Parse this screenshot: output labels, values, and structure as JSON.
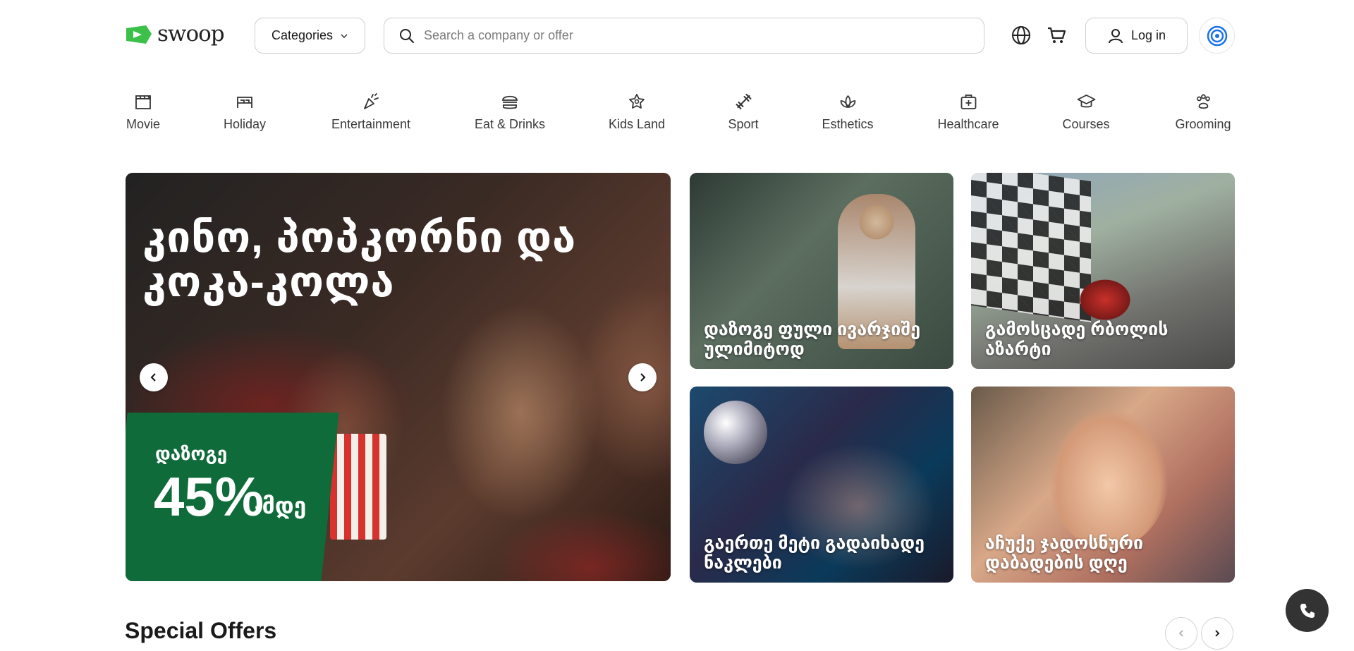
{
  "header": {
    "logo_text": "swoop",
    "categories_label": "Categories",
    "search_placeholder": "Search a company or offer",
    "login_label": "Log in"
  },
  "category_nav": [
    {
      "label": "Movie",
      "icon": "clapperboard-icon"
    },
    {
      "label": "Holiday",
      "icon": "bed-icon"
    },
    {
      "label": "Entertainment",
      "icon": "party-popper-icon"
    },
    {
      "label": "Eat & Drinks",
      "icon": "burger-icon"
    },
    {
      "label": "Kids Land",
      "icon": "star-badge-icon"
    },
    {
      "label": "Sport",
      "icon": "dumbbell-icon"
    },
    {
      "label": "Esthetics",
      "icon": "lotus-icon"
    },
    {
      "label": "Healthcare",
      "icon": "medical-kit-icon"
    },
    {
      "label": "Courses",
      "icon": "graduation-cap-icon"
    },
    {
      "label": "Grooming",
      "icon": "paw-icon"
    }
  ],
  "hero": {
    "title": "კინო, პოპკორნი და კოკა-კოლა",
    "deal_top": "დაზოგე",
    "deal_percent": "45%",
    "deal_suffix": "-მდე"
  },
  "tiles": [
    {
      "caption": "დაზოგე ფული ივარჯიშე ულიმიტოდ"
    },
    {
      "caption": "გამოსცადე რბოლის აზარტი"
    },
    {
      "caption": "გაერთე მეტი გადაიხადე ნაკლები"
    },
    {
      "caption": "აჩუქე ჯადოსნური დაბადების დღე"
    }
  ],
  "special_offers": {
    "title": "Special Offers"
  },
  "colors": {
    "brand_green": "#0f6b3a",
    "logo_green": "#3cc04a",
    "accent_blue": "#1a73e8"
  }
}
